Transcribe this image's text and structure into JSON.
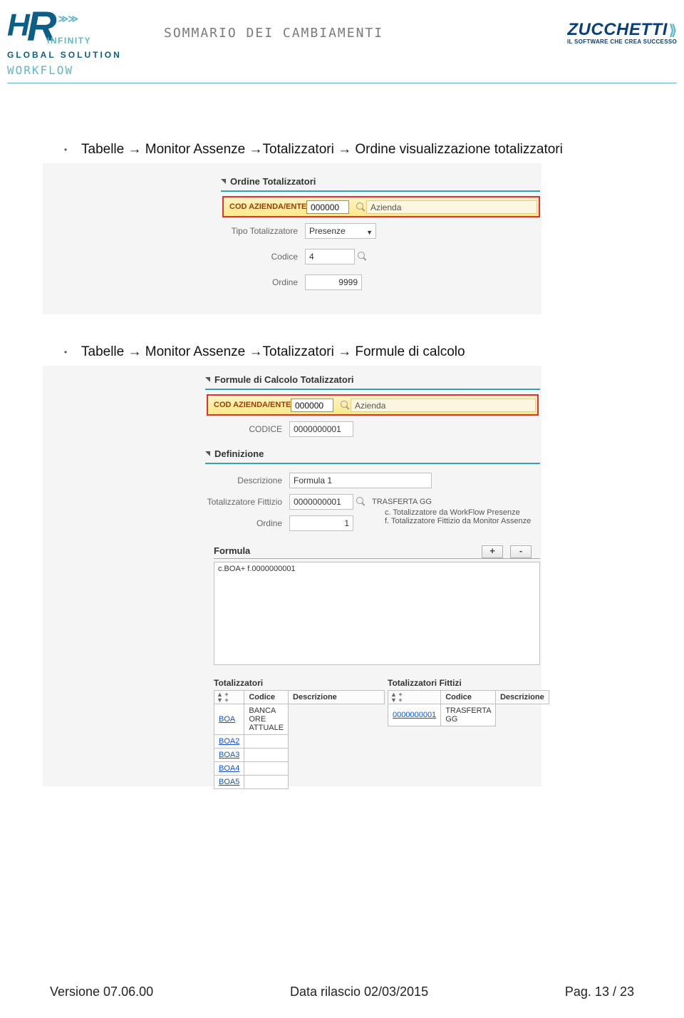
{
  "header": {
    "hr_h": "H",
    "hr_r": "R",
    "hr_infinity": "INFINITY",
    "global_solution": "GLOBAL SOLUTION",
    "workflow": "WORKFLOW",
    "center_title": "SOMMARIO DEI CAMBIAMENTI",
    "zucchetti": "ZUCCHETTI",
    "zucchetti_sub": "IL SOFTWARE CHE CREA SUCCESSO"
  },
  "item1": {
    "title": "Tabelle → Monitor Assenze →Totalizzatori → Ordine visualizzazione totalizzatori",
    "section": "Ordine Totalizzatori",
    "rb_label": "COD AZIENDA/ENTE",
    "rb_code": "000000",
    "rb_name": "Azienda",
    "row_tipo_lbl": "Tipo Totalizzatore",
    "row_tipo_val": "Presenze",
    "row_codice_lbl": "Codice",
    "row_codice_val": "4",
    "row_ordine_lbl": "Ordine",
    "row_ordine_val": "9999"
  },
  "item2": {
    "title": "Tabelle → Monitor Assenze →Totalizzatori → Formule di calcolo",
    "section": "Formule di Calcolo Totalizzatori",
    "rb_label": "COD AZIENDA/ENTE",
    "rb_code": "000000",
    "rb_name": "Azienda",
    "codice_lbl": "CODICE",
    "codice_val": "0000000001",
    "def_section": "Definizione",
    "desc_lbl": "Descrizione",
    "desc_val": "Formula 1",
    "totfit_lbl": "Totalizzatore Fittizio",
    "totfit_val": "0000000001",
    "totfit_txt": "TRASFERTA GG",
    "ordine_lbl": "Ordine",
    "ordine_val": "1",
    "note_c": "c.   Totalizzatore da WorkFlow Presenze",
    "note_f": "f.   Totalizzatore Fittizio da Monitor Assenze",
    "formula_lbl": "Formula",
    "formula_val": "c.BOA+ f.0000000001",
    "btn_plus": "+",
    "btn_minus": "-",
    "tbl1_title": "Totalizzatori",
    "tbl2_title": "Totalizzatori Fittizi",
    "th_codice": "Codice",
    "th_desc": "Descrizione",
    "t1_rows": [
      {
        "code": "BOA",
        "desc": "BANCA ORE ATTUALE"
      },
      {
        "code": "BOA2",
        "desc": ""
      },
      {
        "code": "BOA3",
        "desc": ""
      },
      {
        "code": "BOA4",
        "desc": ""
      },
      {
        "code": "BOA5",
        "desc": ""
      }
    ],
    "t2_rows": [
      {
        "code": "0000000001",
        "desc": "TRASFERTA GG"
      }
    ]
  },
  "footer": {
    "version": "Versione 07.06.00",
    "release": "Data rilascio 02/03/2015",
    "page": "Pag. 13 / 23"
  }
}
